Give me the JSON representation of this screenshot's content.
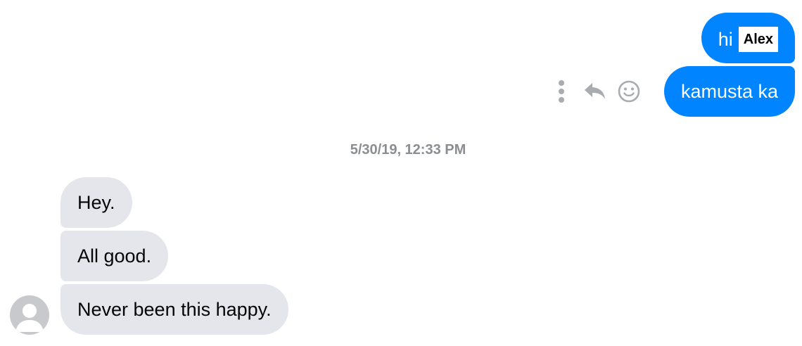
{
  "outgoing": {
    "message_1": {
      "text": "hi",
      "name_tag": "Alex"
    },
    "message_2": {
      "text": "kamusta ka"
    }
  },
  "message_actions": [
    {
      "icon": "more-options-icon"
    },
    {
      "icon": "reply-icon"
    },
    {
      "icon": "react-smiley-icon"
    }
  ],
  "timestamp": "5/30/19, 12:33 PM",
  "incoming": {
    "messages": [
      {
        "text": "Hey."
      },
      {
        "text": "All good."
      },
      {
        "text": "Never been this happy."
      }
    ],
    "avatar": {
      "icon": "default-avatar-icon"
    }
  },
  "colors": {
    "outgoing_bubble": "#0084ff",
    "incoming_bubble": "#e4e6eb",
    "timestamp": "#8a8d91",
    "action_icons": "#a8abaf"
  }
}
